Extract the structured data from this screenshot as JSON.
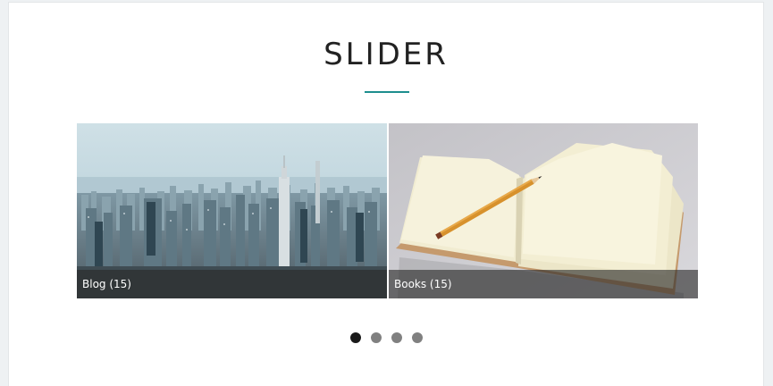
{
  "section": {
    "title": "SLIDER",
    "accent_color": "#1d8e8e"
  },
  "slider": {
    "slides": [
      {
        "caption": "Blog (15)",
        "image": "city-skyline-photo"
      },
      {
        "caption": "Books (15)",
        "image": "open-notebook-with-pencil-photo"
      }
    ],
    "pagination": {
      "count": 4,
      "active_index": 0,
      "active_color": "#1a1a1a",
      "inactive_color": "#808080"
    }
  }
}
